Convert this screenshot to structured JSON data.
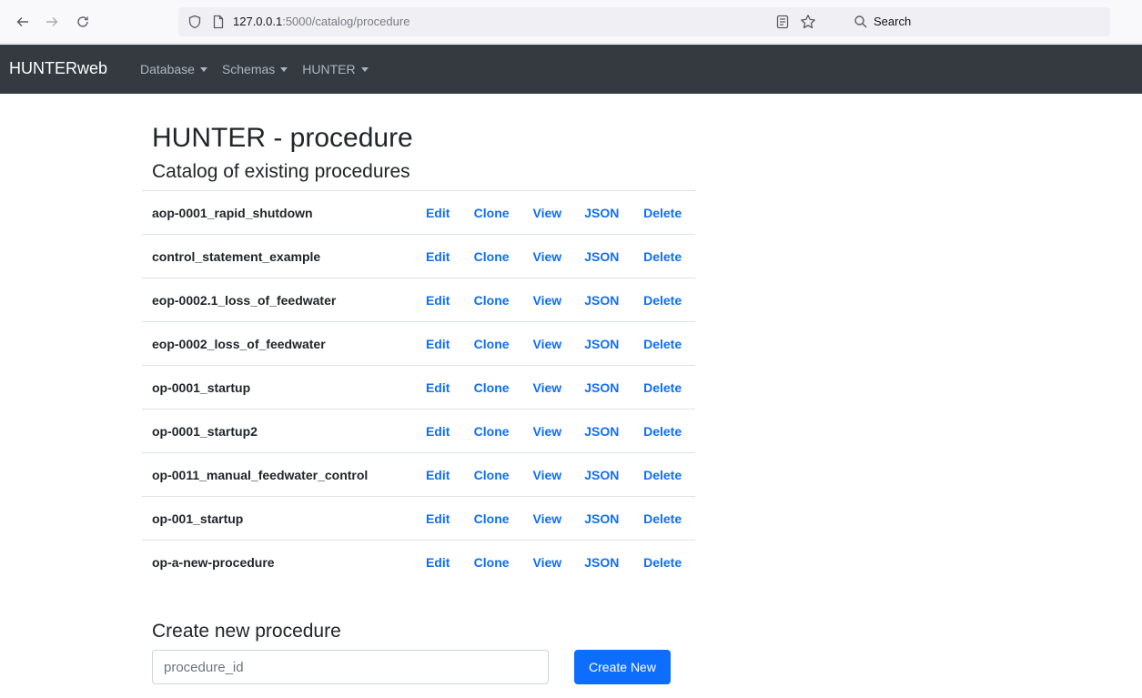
{
  "browser": {
    "url_host": "127.0.0.1",
    "url_rest": ":5000/catalog/procedure",
    "search_placeholder": "Search"
  },
  "navbar": {
    "brand": "HUNTERweb",
    "menus": [
      {
        "label": "Database"
      },
      {
        "label": "Schemas"
      },
      {
        "label": "HUNTER"
      }
    ]
  },
  "page": {
    "title": "HUNTER - procedure",
    "subtitle": "Catalog of existing procedures"
  },
  "actions": {
    "edit": "Edit",
    "clone": "Clone",
    "view": "View",
    "json": "JSON",
    "delete": "Delete"
  },
  "procedures": [
    {
      "name": "aop-0001_rapid_shutdown"
    },
    {
      "name": "control_statement_example"
    },
    {
      "name": "eop-0002.1_loss_of_feedwater"
    },
    {
      "name": "eop-0002_loss_of_feedwater"
    },
    {
      "name": "op-0001_startup"
    },
    {
      "name": "op-0001_startup2"
    },
    {
      "name": "op-0011_manual_feedwater_control"
    },
    {
      "name": "op-001_startup"
    },
    {
      "name": "op-a-new-procedure"
    }
  ],
  "create": {
    "heading": "Create new procedure",
    "input_placeholder": "procedure_id",
    "button_label": "Create New"
  },
  "colors": {
    "navbar_bg": "#343a40",
    "link": "#0d6efd",
    "button_primary": "#0d6efd"
  }
}
